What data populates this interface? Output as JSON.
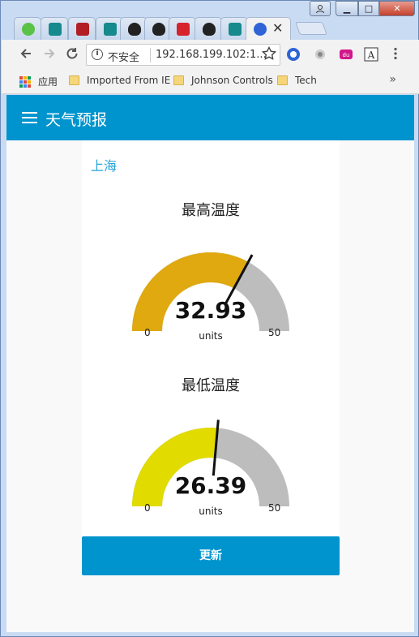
{
  "browser": {
    "tabs": [
      {
        "icon": "wechat-icon",
        "color": "#5ac246"
      },
      {
        "icon": "bing-icon",
        "color": "#168a8c"
      },
      {
        "icon": "cdc-icon",
        "color": "#b11f24"
      },
      {
        "icon": "bing-icon",
        "color": "#168a8c"
      },
      {
        "icon": "tux-icon",
        "color": "#222222"
      },
      {
        "icon": "tux-icon",
        "color": "#222222"
      },
      {
        "icon": "netease-icon",
        "color": "#d6232c"
      },
      {
        "icon": "tux-icon",
        "color": "#222222"
      },
      {
        "icon": "bing-icon",
        "color": "#168a8c"
      },
      {
        "icon": "baidu-paw-icon",
        "color": "#2f63d6"
      }
    ],
    "active_tab_close": "✕",
    "window_buttons": {
      "minimize": "▁",
      "maximize": "□",
      "close": "✕"
    },
    "security_label": "不安全",
    "url": "192.168.199.102:1...",
    "bookmarks": {
      "apps": "应用",
      "items": [
        "Imported From IE",
        "Johnson Controls",
        "Tech"
      ],
      "more": "»"
    }
  },
  "app": {
    "title": "天气预报",
    "city": "上海",
    "update_button": "更新"
  },
  "gauges": [
    {
      "title": "最高温度",
      "value_text": "32.93",
      "value": 32.93,
      "min": 0,
      "max": 50,
      "min_label": "0",
      "max_label": "50",
      "units": "units",
      "color": "#dfa90f"
    },
    {
      "title": "最低温度",
      "value_text": "26.39",
      "value": 26.39,
      "min": 0,
      "max": 50,
      "min_label": "0",
      "max_label": "50",
      "units": "units",
      "color": "#e1db00"
    }
  ]
}
